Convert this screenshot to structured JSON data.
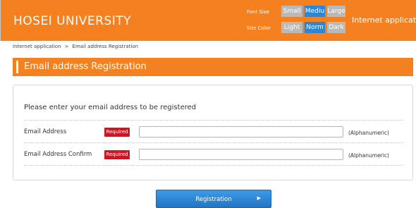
{
  "header": {
    "site_title": "HOSEI UNIVERSITY",
    "font_size_label": "Font Size",
    "site_color_label": "Site Color",
    "font_sizes": [
      {
        "label": "Small",
        "active": false
      },
      {
        "label": "Mediu",
        "active": true
      },
      {
        "label": "Large",
        "active": false
      }
    ],
    "site_colors": [
      {
        "label": "Light",
        "active": false
      },
      {
        "label": "Norm",
        "active": true
      },
      {
        "label": "Dark",
        "active": false
      }
    ],
    "internet_application": "Internet application"
  },
  "breadcrumb": {
    "parent": "Internet application",
    "separator": ">",
    "current": "Email address Registration"
  },
  "page_title": "Email address Registration",
  "form": {
    "heading": "Please enter your email address to be registered",
    "rows": [
      {
        "label": "Email Address",
        "required": "Required",
        "value": "",
        "hint": "(Alphanumeric)"
      },
      {
        "label": "Email Address Confirm",
        "required": "Required",
        "value": "",
        "hint": "(Alphanumeric)"
      }
    ]
  },
  "submit": {
    "label": "Registration",
    "arrow": "▶"
  },
  "colors": {
    "brand": "#f4801f",
    "accent_blue": "#2b86d6",
    "required_red": "#d8111e"
  }
}
